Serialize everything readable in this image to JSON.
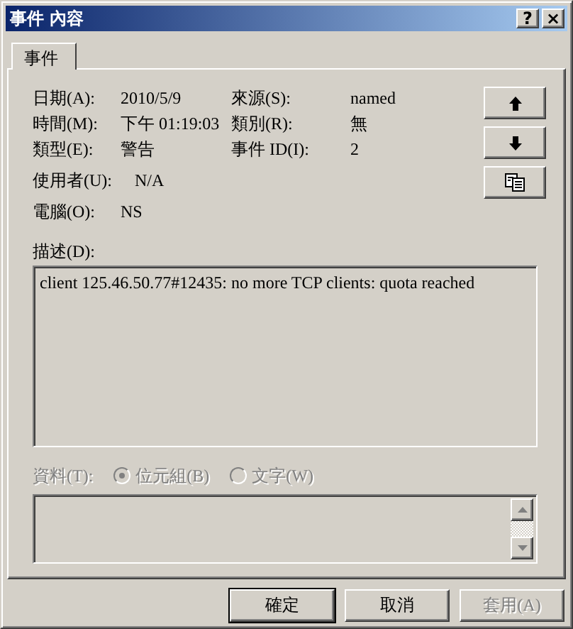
{
  "window": {
    "title": "事件 內容",
    "title_buttons": [
      "?",
      "×"
    ]
  },
  "tabs": [
    {
      "label": "事件",
      "selected": true
    }
  ],
  "field_rows": [
    [
      {
        "label": "日期(A):",
        "value": "2010/5/9"
      },
      {
        "label": "來源(S):",
        "value": "named"
      }
    ],
    [
      {
        "label": "時間(M):",
        "value": "下午 01:19:03"
      },
      {
        "label": "類別(R):",
        "value": "無"
      }
    ],
    [
      {
        "label": "類型(E):",
        "value": "警告"
      },
      {
        "label": "事件 ID(I):",
        "value": "2"
      }
    ],
    [
      {
        "label": "使用者(U):",
        "value": "N/A"
      }
    ],
    [
      {
        "label": "電腦(O):",
        "value": "NS"
      }
    ]
  ],
  "side_buttons": [
    {
      "kind": "up"
    },
    {
      "kind": "down"
    },
    {
      "kind": "copy"
    }
  ],
  "description": {
    "label": "描述(D):",
    "value": "client 125.46.50.77#12435: no more TCP clients: quota reached"
  },
  "data": {
    "label": "資料(T):",
    "disabled": true,
    "options": [
      {
        "label": "位元組(B)",
        "selected": true
      },
      {
        "label": "文字(W)",
        "selected": false
      }
    ]
  },
  "buttons": [
    {
      "label": "確定",
      "disabled": false,
      "default": true
    },
    {
      "label": "取消",
      "disabled": false,
      "default": false
    },
    {
      "label": "套用(A)",
      "disabled": true,
      "default": false
    }
  ]
}
